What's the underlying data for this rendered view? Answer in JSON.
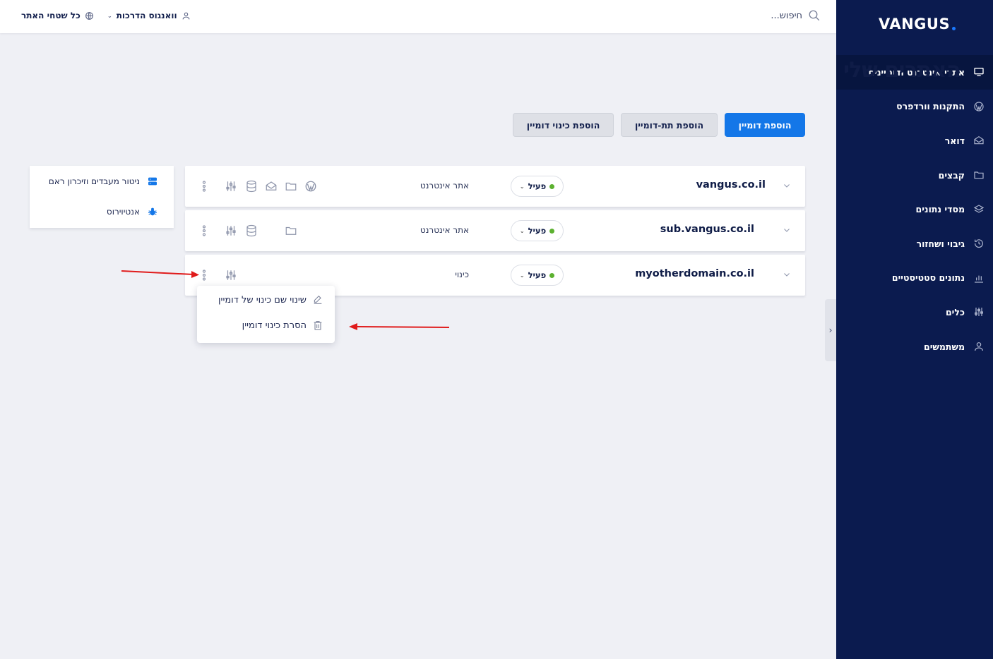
{
  "brand": {
    "logo_text": "VANGUS",
    "accent_color": "#1477e8",
    "sidebar_bg": "#0b1b4f"
  },
  "topbar": {
    "search_placeholder": "חיפוש...",
    "account_label": "וואנגוס הדרכות",
    "sites_label": "כל שטחי האתר"
  },
  "sidebar": {
    "items": [
      {
        "label": "אתרי אינטרנט ודומיינים",
        "icon": "monitor-icon",
        "active": true
      },
      {
        "label": "התקנות וורדפרס",
        "icon": "wordpress-icon"
      },
      {
        "label": "דואר",
        "icon": "mail-icon"
      },
      {
        "label": "קבצים",
        "icon": "folder-icon"
      },
      {
        "label": "מסדי נתונים",
        "icon": "layers-icon"
      },
      {
        "label": "גיבוי ושחזור",
        "icon": "backup-icon"
      },
      {
        "label": "נתונים סטטיסטיים",
        "icon": "stats-icon"
      },
      {
        "label": "כלים",
        "icon": "tools-icon"
      },
      {
        "label": "משתמשים",
        "icon": "user-icon"
      }
    ]
  },
  "page": {
    "title": "האתרים שלי"
  },
  "actions": {
    "add_domain": "הוספת דומיין",
    "add_subdomain": "הוספת תת-דומיין",
    "add_alias": "הוספת כינוי דומיין"
  },
  "rows": [
    {
      "domain": "vangus.co.il",
      "status": "פעיל",
      "type": "אתר אינטרנט"
    },
    {
      "domain": "sub.vangus.co.il",
      "status": "פעיל",
      "type": "אתר אינטרנט"
    },
    {
      "domain": "myotherdomain.co.il",
      "status": "פעיל",
      "type": "כינוי"
    }
  ],
  "context_menu": {
    "rename": "שינוי שם כינוי של דומיין",
    "remove": "הסרת כינוי דומיין"
  },
  "widget": {
    "monitor": "ניטור מעבדים וזיכרון ראם",
    "antivirus": "אנטיוירוס"
  }
}
